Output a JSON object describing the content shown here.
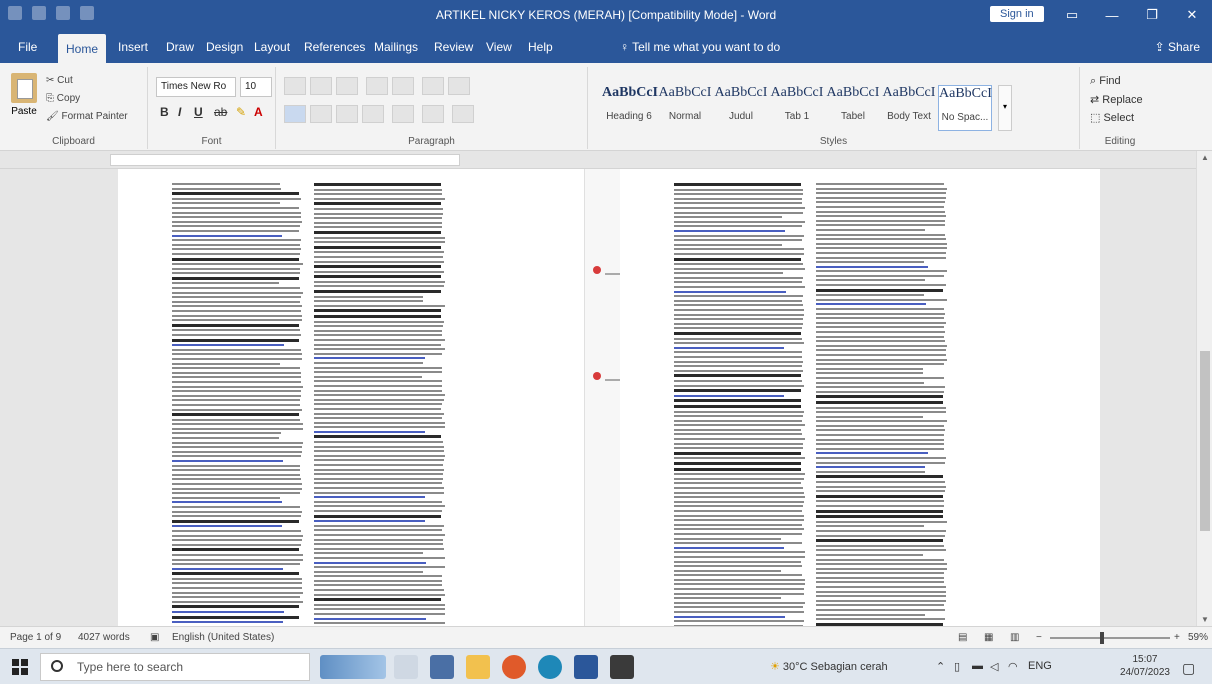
{
  "window": {
    "title": "ARTIKEL NICKY KEROS (MERAH) [Compatibility Mode] - Word",
    "sign_in": "Sign in"
  },
  "tabs": [
    "File",
    "Home",
    "Insert",
    "Draw",
    "Design",
    "Layout",
    "References",
    "Mailings",
    "Review",
    "View",
    "Help"
  ],
  "tell_me": "Tell me what you want to do",
  "share": "Share",
  "ribbon": {
    "clipboard": {
      "paste": "Paste",
      "cut": "Cut",
      "copy": "Copy",
      "format_painter": "Format Painter",
      "label": "Clipboard"
    },
    "font": {
      "name": "Times New Ro",
      "size": "10",
      "label": "Font"
    },
    "paragraph": {
      "label": "Paragraph"
    },
    "styles": {
      "label": "Styles",
      "items": [
        {
          "preview": "AaBbCcI",
          "name": "Heading 6"
        },
        {
          "preview": "AaBbCcI",
          "name": "Normal"
        },
        {
          "preview": "AaBbCcI",
          "name": "Judul"
        },
        {
          "preview": "AaBbCcI",
          "name": "Tab 1"
        },
        {
          "preview": "AaBbCcI",
          "name": "Tabel"
        },
        {
          "preview": "AaBbCcI",
          "name": "Body Text"
        },
        {
          "preview": "AaBbCcI",
          "name": "No Spac..."
        }
      ]
    },
    "editing": {
      "find": "Find",
      "replace": "Replace",
      "select": "Select",
      "label": "Editing"
    }
  },
  "statusbar": {
    "page": "Page 1 of 9",
    "words": "4027 words",
    "language": "English (United States)",
    "zoom": "59%"
  },
  "taskbar": {
    "search_placeholder": "Type here to search",
    "weather": "30°C Sebagian cerah",
    "lang": "ENG",
    "time": "15:07",
    "date": "24/07/2023"
  },
  "colors": {
    "word_blue": "#2b579a",
    "ribbon_bg": "#f3f3f3",
    "comment_dot": "#d83b3b"
  }
}
